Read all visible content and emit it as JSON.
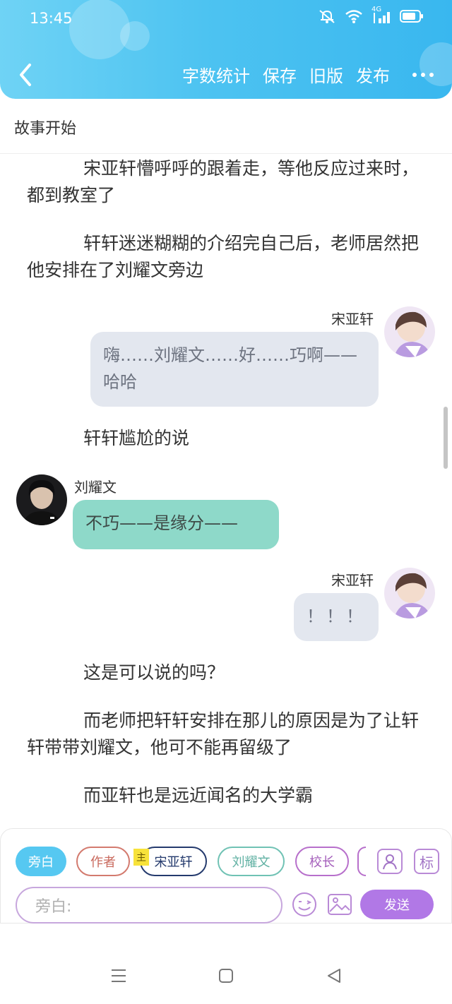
{
  "status_bar": {
    "time": "13:45",
    "network": "4G"
  },
  "toolbar": {
    "word_count": "字数统计",
    "save": "保存",
    "old_version": "旧版",
    "publish": "发布"
  },
  "chapter_title": "故事开始",
  "story": {
    "p1": "宋亚轩懵呼呼的跟着走，等他反应过来时，都到教室了",
    "p2": "轩轩迷迷糊糊的介绍完自己后，老师居然把他安排在了刘耀文旁边",
    "msg1_name": "宋亚轩",
    "msg1_text": "嗨……刘耀文……好……巧啊——哈哈",
    "p3": "轩轩尴尬的说",
    "msg2_name": "刘耀文",
    "msg2_text": "不巧——是缘分——",
    "msg3_name": "宋亚轩",
    "msg3_text": "！！！",
    "p4": "这是可以说的吗？",
    "p5": "而老师把轩轩安排在那儿的原因是为了让轩轩带带刘耀文，他可不能再留级了",
    "p6": "而亚轩也是远近闻名的大学霸"
  },
  "roles": {
    "narration": "旁白",
    "author": "作者",
    "main_tag": "主",
    "song": "宋亚轩",
    "liu": "刘耀文",
    "principal": "校长"
  },
  "tools": {
    "tag_label": "标"
  },
  "composer": {
    "placeholder": "旁白:",
    "send": "发送"
  },
  "colors": {
    "header": "#4dc3f1",
    "narration_chip": "#56c8f1",
    "send_button": "#b178e6",
    "right_bubble": "#e3e7ef",
    "left_bubble": "#8ed9c9"
  }
}
